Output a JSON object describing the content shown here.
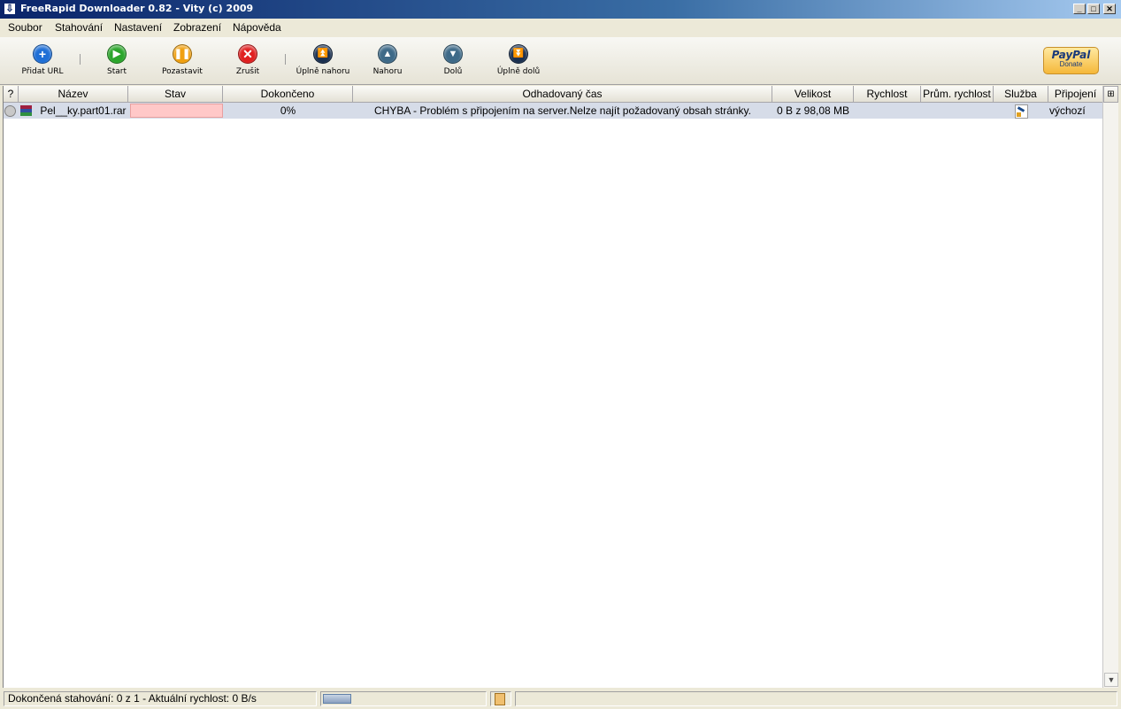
{
  "window": {
    "title": "FreeRapid Downloader 0.82 - Vity (c) 2009"
  },
  "menu": [
    "Soubor",
    "Stahování",
    "Nastavení",
    "Zobrazení",
    "Nápověda"
  ],
  "toolbar": {
    "buttons": [
      {
        "label": "Přidat URL",
        "icon": "add-icon",
        "color": "#1f6fd6"
      },
      {
        "label": "Start",
        "icon": "play-icon",
        "color": "#2aa52a"
      },
      {
        "label": "Pozastavit",
        "icon": "pause-icon",
        "color": "#f0a010"
      },
      {
        "label": "Zrušit",
        "icon": "cancel-icon",
        "color": "#e02020"
      },
      {
        "label": "Úplně nahoru",
        "icon": "move-top-icon",
        "color": "#1a3050"
      },
      {
        "label": "Nahoru",
        "icon": "move-up-icon",
        "color": "#3e6a88"
      },
      {
        "label": "Dolů",
        "icon": "move-down-icon",
        "color": "#3e6a88"
      },
      {
        "label": "Úplně dolů",
        "icon": "move-bottom-icon",
        "color": "#1a3050"
      }
    ],
    "paypal": {
      "brand": "PayPal",
      "label": "Donate"
    }
  },
  "table": {
    "columns": [
      "?",
      "Název",
      "Stav",
      "Dokončeno",
      "Odhadovaný čas",
      "Velikost",
      "Rychlost",
      "Prům. rychlost",
      "Služba",
      "Připojení"
    ],
    "rows": [
      {
        "name": "Pel__ky.part01.rar",
        "status": "",
        "completed": "0%",
        "estimated": "CHYBA - Problém s připojením na server.Nelze najít požadovaný obsah stránky.",
        "size": "0 B z 98,08 MB",
        "speed": "",
        "avg_speed": "",
        "service": "service-icon",
        "connection": "výchozí"
      }
    ]
  },
  "statusbar": {
    "text": "Dokončená stahování: 0 z 1 - Aktuální rychlost: 0 B/s"
  },
  "colors": {
    "status_error": "#ffc8c8",
    "row_selected": "#d6dce8"
  }
}
